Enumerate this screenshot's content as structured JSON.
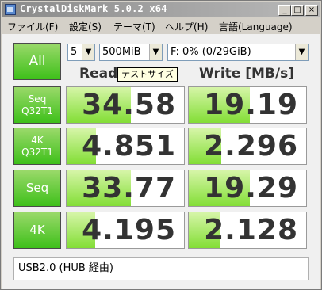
{
  "window": {
    "title": "CrystalDiskMark 5.0.2 x64",
    "minimize_glyph": "_",
    "maximize_glyph": "□",
    "close_glyph": "×"
  },
  "menu": [
    "ファイル(F)",
    "設定(S)",
    "テーマ(T)",
    "ヘルプ(H)",
    "言語(Language)"
  ],
  "controls": {
    "all_label": "All",
    "count": "5",
    "size": "500MiB",
    "drive": "F: 0% (0/29GiB)"
  },
  "headers": {
    "read": "Read",
    "write": "Write [MB/s]",
    "tooltip": "テストサイズ"
  },
  "rows": [
    {
      "label_line1": "Seq",
      "label_line2": "Q32T1",
      "read": "34.58",
      "write": "19.19",
      "read_fill": 0.55,
      "write_fill": 0.52
    },
    {
      "label_line1": "4K",
      "label_line2": "Q32T1",
      "read": "4.851",
      "write": "2.296",
      "read_fill": 0.25,
      "write_fill": 0.28
    },
    {
      "label_line1": "Seq",
      "label_line2": "",
      "read": "33.77",
      "write": "19.29",
      "read_fill": 0.55,
      "write_fill": 0.52
    },
    {
      "label_line1": "4K",
      "label_line2": "",
      "read": "4.195",
      "write": "2.128",
      "read_fill": 0.24,
      "write_fill": 0.27
    }
  ],
  "comment": "USB2.0 (HUB 経由)",
  "colors": {
    "accent_green": "#3ec01a",
    "bar_green": "#83de36",
    "title_bar": "#8a8a8a"
  }
}
